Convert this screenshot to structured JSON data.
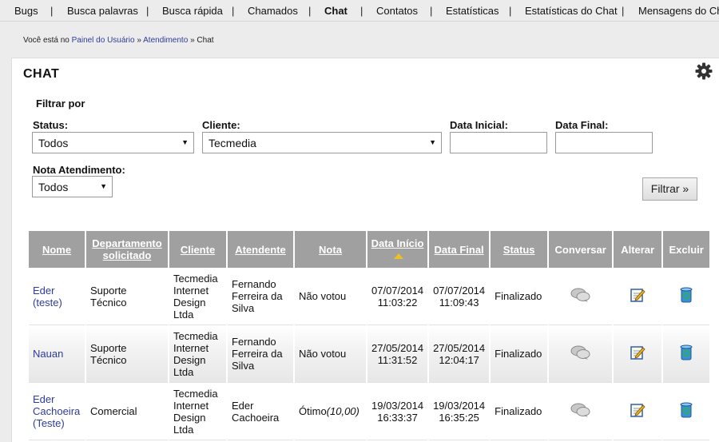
{
  "nav": [
    "Bugs",
    "Busca palavras",
    "Busca rápida",
    "Chamados",
    "Chat",
    "Contatos",
    "Estatísticas",
    "Estatísticas do Chat",
    "Mensagens do Chat"
  ],
  "breadcrumb": {
    "prefix": "Você está no",
    "home": "Painel do Usuário",
    "sep1": "»",
    "section": "Atendimento",
    "sep2": "»",
    "current": "Chat"
  },
  "page_title": "CHAT",
  "filter": {
    "title": "Filtrar por",
    "status_label": "Status:",
    "status_value": "Todos",
    "client_label": "Cliente:",
    "client_value": "Tecmedia",
    "start_label": "Data Inicial:",
    "end_label": "Data Final:",
    "rating_label": "Nota Atendimento:",
    "rating_value": "Todos",
    "button": "Filtrar »"
  },
  "table": {
    "headers": [
      "Nome",
      "Departamento solicitado",
      "Cliente",
      "Atendente",
      "Nota",
      "Data Início",
      "Data Final",
      "Status",
      "Conversar",
      "Alterar",
      "Excluir"
    ],
    "rows": [
      {
        "name": "Eder (teste)",
        "dept": "Suporte Técnico",
        "client": "Tecmedia Internet Design Ltda",
        "agent": "Fernando Ferreira da Silva",
        "rating": "Não votou",
        "rating_score": "",
        "start_date": "07/07/2014",
        "start_time": "11:03:22",
        "end_date": "07/07/2014",
        "end_time": "11:09:43",
        "status": "Finalizado"
      },
      {
        "name": "Nauan",
        "dept": "Suporte Técnico",
        "client": "Tecmedia Internet Design Ltda",
        "agent": "Fernando Ferreira da Silva",
        "rating": "Não votou",
        "rating_score": "",
        "start_date": "27/05/2014",
        "start_time": "11:31:52",
        "end_date": "27/05/2014",
        "end_time": "12:04:17",
        "status": "Finalizado"
      },
      {
        "name": "Eder Cachoeira (Teste)",
        "dept": "Comercial",
        "client": "Tecmedia Internet Design Ltda",
        "agent": "Eder Cachoeira",
        "rating": "Ótimo",
        "rating_score": "(10,00)",
        "start_date": "19/03/2014",
        "start_time": "16:33:37",
        "end_date": "19/03/2014",
        "end_time": "16:35:25",
        "status": "Finalizado"
      }
    ]
  },
  "icons": {
    "settings": "gear-icon",
    "chat": "chat-bubbles-icon",
    "edit": "edit-note-icon",
    "delete": "recycle-bin-icon",
    "sort": "sort-ascending-icon"
  }
}
